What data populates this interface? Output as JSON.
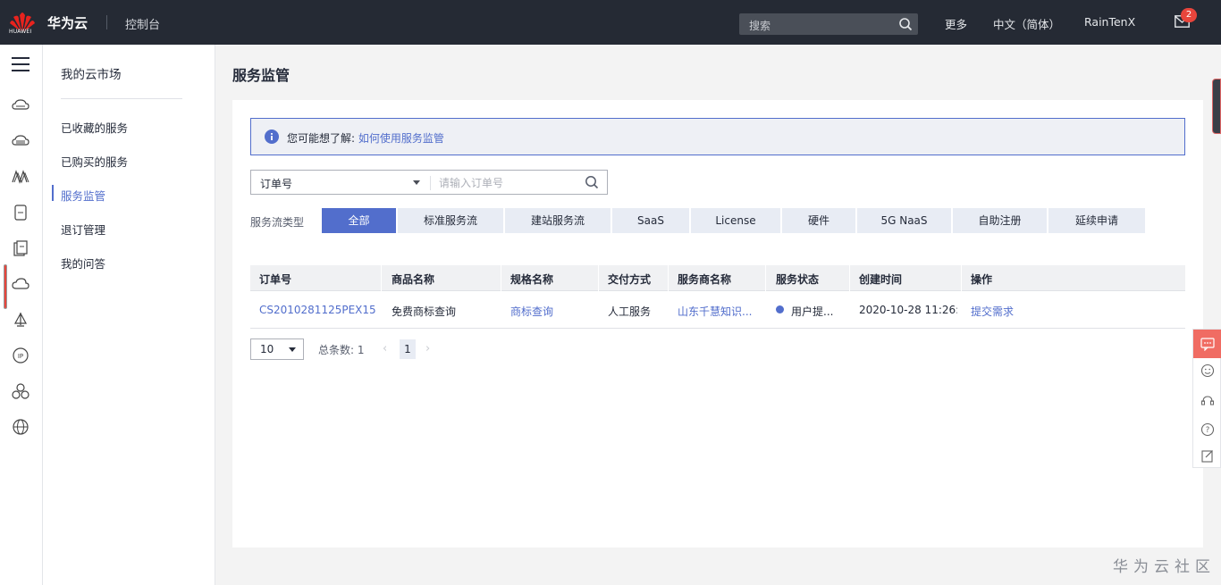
{
  "header": {
    "logo_text": "HUAWEI",
    "brand": "华为云",
    "console": "控制台",
    "search_placeholder": "搜索",
    "more": "更多",
    "language": "中文（简体）",
    "user": "RainTenX",
    "mail_badge": "2"
  },
  "rail": {
    "icons": [
      "cloud-server-icon",
      "cloud-storage-icon",
      "network-icon",
      "document-icon",
      "certificate-icon",
      "cloud-icon",
      "sail-icon",
      "ip-icon",
      "cluster-icon",
      "globe-icon"
    ]
  },
  "subnav": {
    "title": "我的云市场",
    "items": [
      {
        "label": "已收藏的服务"
      },
      {
        "label": "已购买的服务"
      },
      {
        "label": "服务监管"
      },
      {
        "label": "退订管理"
      },
      {
        "label": "我的问答"
      }
    ]
  },
  "main": {
    "title": "服务监管",
    "info": {
      "text": "您可能想了解:",
      "link": "如何使用服务监管"
    },
    "filter": {
      "field": "订单号",
      "placeholder": "请输入订单号"
    },
    "type_label": "服务流类型",
    "tabs": [
      {
        "label": "全部",
        "active": true
      },
      {
        "label": "标准服务流"
      },
      {
        "label": "建站服务流"
      },
      {
        "label": "SaaS"
      },
      {
        "label": "License"
      },
      {
        "label": "硬件"
      },
      {
        "label": "5G NaaS"
      },
      {
        "label": "自助注册"
      },
      {
        "label": "延续申请"
      }
    ],
    "table": {
      "columns": [
        "订单号",
        "商品名称",
        "规格名称",
        "交付方式",
        "服务商名称",
        "服务状态",
        "创建时间",
        "操作"
      ],
      "rows": [
        {
          "order_no": "CS2010281125PEX15",
          "product": "免费商标查询",
          "spec": "商标查询",
          "delivery": "人工服务",
          "vendor": "山东千慧知识...",
          "status": "用户提...",
          "created": "2020-10-28 11:26:...",
          "action": "提交需求"
        }
      ]
    },
    "pagination": {
      "page_size": "10",
      "total": "总条数: 1",
      "current": "1"
    }
  },
  "watermark": "华为云社区",
  "colors": {
    "topbar": "#252a34",
    "accent": "#526ecc",
    "chat": "#f06c63"
  }
}
